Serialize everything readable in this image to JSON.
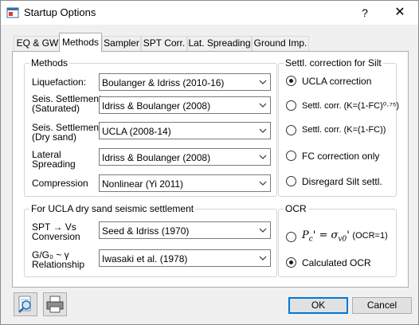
{
  "window": {
    "title": "Startup Options",
    "help_label": "?",
    "close_label": "✕"
  },
  "tabs": [
    {
      "label": "EQ & GW",
      "active": false
    },
    {
      "label": "Methods",
      "active": true
    },
    {
      "label": "Sampler",
      "active": false
    },
    {
      "label": "SPT Corr.",
      "active": false
    },
    {
      "label": "Lat. Spreading",
      "active": false
    },
    {
      "label": "Ground Imp.",
      "active": false
    }
  ],
  "methods": {
    "title": "Methods",
    "rows": [
      {
        "label": "Liquefaction:",
        "value": "Boulanger & Idriss (2010-16)"
      },
      {
        "label_line1": "Seis. Settlement",
        "label_line2": "(Saturated)",
        "value": "Idriss & Boulanger (2008)"
      },
      {
        "label_line1": "Seis. Settlement",
        "label_line2": "(Dry sand)",
        "value": "UCLA (2008-14)"
      },
      {
        "label_line1": "Lateral",
        "label_line2": "Spreading",
        "value": "Idriss & Boulanger (2008)"
      },
      {
        "label": "Compression",
        "value": "Nonlinear (Yi 2011)"
      }
    ]
  },
  "ucla_dry": {
    "title": "For UCLA dry sand seismic settlement",
    "rows": [
      {
        "label_line1": "SPT → Vs",
        "label_line2": "Conversion",
        "value": "Seed & Idriss (1970)"
      },
      {
        "label_line1": "G/G₀ ~ γ",
        "label_line2": "Relationship",
        "value": "Iwasaki et al. (1978)"
      }
    ]
  },
  "silt": {
    "title": "Settl. correction for Silt",
    "options": [
      {
        "label": "UCLA correction",
        "selected": true
      },
      {
        "label": "Settl. corr. (K=(1-FC)⁰·⁷⁵)",
        "selected": false
      },
      {
        "label": "Settl. corr. (K=(1-FC))",
        "selected": false
      },
      {
        "label": "FC correction only",
        "selected": false
      },
      {
        "label": "Disregard Silt settl.",
        "selected": false
      }
    ]
  },
  "ocr": {
    "title": "OCR",
    "option1_formula_lhs": "P",
    "option1_formula_sub": "c",
    "option1_formula_prime": "' = σ",
    "option1_formula_sub2": "v0",
    "option1_formula_end": "'",
    "option1_suffix": "(OCR=1)",
    "option1_selected": false,
    "option2_label": "Calculated OCR",
    "option2_selected": true
  },
  "footer": {
    "ok_label": "OK",
    "cancel_label": "Cancel"
  },
  "icons": {
    "app": "app-window-icon",
    "preview": "magnifier-preview-icon",
    "print": "printer-icon"
  }
}
